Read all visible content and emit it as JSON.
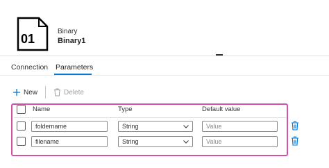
{
  "dataset": {
    "icon_text": "01",
    "type_label": "Binary",
    "name": "Binary1"
  },
  "tabs": [
    {
      "label": "Connection",
      "active": false
    },
    {
      "label": "Parameters",
      "active": true
    }
  ],
  "toolbar": {
    "new_label": "New",
    "delete_label": "Delete"
  },
  "parameters_table": {
    "columns": [
      "Name",
      "Type",
      "Default value"
    ],
    "rows": [
      {
        "name": "foldername",
        "type": "String",
        "default_value": "",
        "default_placeholder": "Value"
      },
      {
        "name": "filename",
        "type": "String",
        "default_value": "",
        "default_placeholder": "Value"
      }
    ]
  },
  "colors": {
    "accent": "#0078d4",
    "highlight_border": "#d44fa8",
    "delete_icon": "#0078d4"
  }
}
